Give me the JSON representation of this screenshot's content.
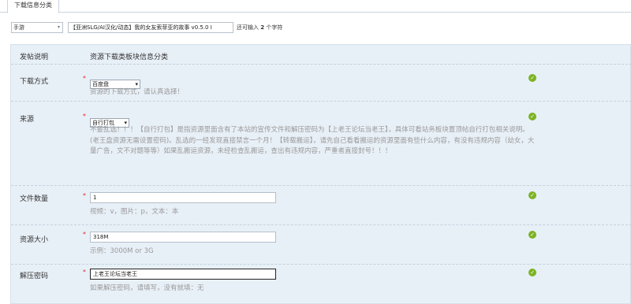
{
  "tabs": [
    {
      "label": "下载信息分类"
    }
  ],
  "title_row": {
    "type_select": "手游",
    "title_value": "【亚洲SLG/AI汉化/动态】我的女友索菲亚的故事 v0.5.0 I",
    "remain_prefix": "还可输入",
    "remain_count": "2",
    "remain_suffix": "个字符"
  },
  "form": {
    "header": {
      "label": "发帖说明",
      "value": "资源下载类板块信息分类"
    },
    "download_method": {
      "label": "下载方式",
      "required": "*",
      "selected": "百度盘",
      "hint": "资源的下载方式，请认真选择！"
    },
    "source": {
      "label": "来源",
      "required": "*",
      "selected": "自行打包",
      "note": "不要乱选！！！【自行打包】是指资源里面含有了本站的宣传文件和解压密码为【上老王论坛当老王】，具体可看站务板块置顶帖自行打包相关说明。(老王盘资源无需设置密码)。乱选的一经发现直接禁言一个月！【转载搬运】，请先自己看看搬运的资源里面有些什么内容，有没有违规内容（幼女，大量广告，文不对题等等）如果乱搬运资源，未经检查乱搬运，查出有违规内容，严重者直接封号！！！"
    },
    "file_count": {
      "label": "文件数量",
      "required": "*",
      "value": "1",
      "hint": "视频：v，图片：p，文本：本"
    },
    "resource_size": {
      "label": "资源大小",
      "required": "*",
      "value": "318M",
      "hint": "示例：3000M or 3G"
    },
    "extract_password": {
      "label": "解压密码",
      "required": "*",
      "value": "上老王论坛当老王",
      "hint": "如果解压密码，请填写，没有就填：无"
    }
  },
  "status": {
    "valid_icon": "check-circle-icon",
    "valid_color": "#7cb324",
    "required_color": "#e02a2a"
  }
}
